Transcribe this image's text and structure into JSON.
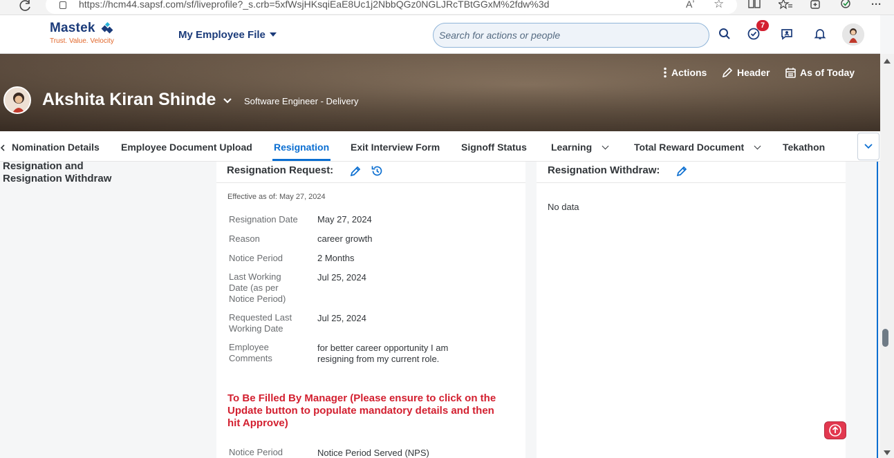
{
  "browser": {
    "url": "https://hcm44.sapsf.com/sf/liveprofile?_s.crb=5xfWsjHKsqiEaE8Uc1j2NbbQGz0NGLJRcTBtGGxM%2fdw%3d",
    "read_aloud": "Aʼ"
  },
  "shell": {
    "logo_name": "Mastek",
    "logo_tagline": "Trust. Value. Velocity",
    "module": "My Employee File",
    "search_placeholder": "Search for actions or people",
    "todo_badge": "7"
  },
  "banner": {
    "actions_label": "Actions",
    "header_label": "Header",
    "asof_label": "As of Today",
    "person_name": "Akshita Kiran Shinde",
    "person_title": "Software Engineer - Delivery"
  },
  "tabs": [
    {
      "label": "Nomination Details"
    },
    {
      "label": "Employee Document Upload"
    },
    {
      "label": "Resignation"
    },
    {
      "label": "Exit Interview Form"
    },
    {
      "label": "Signoff Status"
    },
    {
      "label": "Learning"
    },
    {
      "label": "Total Reward Document"
    },
    {
      "label": "Tekathon"
    }
  ],
  "section": {
    "title_line1": "Resignation and",
    "title_line2": "Resignation Withdraw"
  },
  "request": {
    "title": "Resignation Request:",
    "effective": "Effective as of: May 27, 2024",
    "fields": [
      {
        "label": "Resignation Date",
        "value": "May 27, 2024"
      },
      {
        "label": "Reason",
        "value": "career growth"
      },
      {
        "label": "Notice Period",
        "value": "2 Months"
      },
      {
        "label_l1": "Last Working",
        "label_l2": "Date (as per",
        "label_l3": "Notice Period)",
        "value": "Jul 25, 2024"
      },
      {
        "label_l1": "Requested Last",
        "label_l2": "Working Date",
        "value": "Jul 25, 2024"
      },
      {
        "label_l1": "Employee",
        "label_l2": "Comments",
        "value_l1": "for better career opportunity I am",
        "value_l2": "resigning from my current role."
      }
    ],
    "manager_l1": "To Be Filled By Manager (Please ensure to click on the",
    "manager_l2": "Update button to populate mandatory details and then",
    "manager_l3": "hit Approve)",
    "manager_field_label": "Notice Period",
    "manager_field_value": "Notice Period Served (NPS)"
  },
  "withdraw": {
    "title": "Resignation Withdraw:",
    "no_data": "No data"
  },
  "colors": {
    "brand_navy": "#1b3b7a",
    "accent_blue": "#0a6ed1",
    "alert_red": "#d32030",
    "tagline_orange": "#e2672b"
  }
}
